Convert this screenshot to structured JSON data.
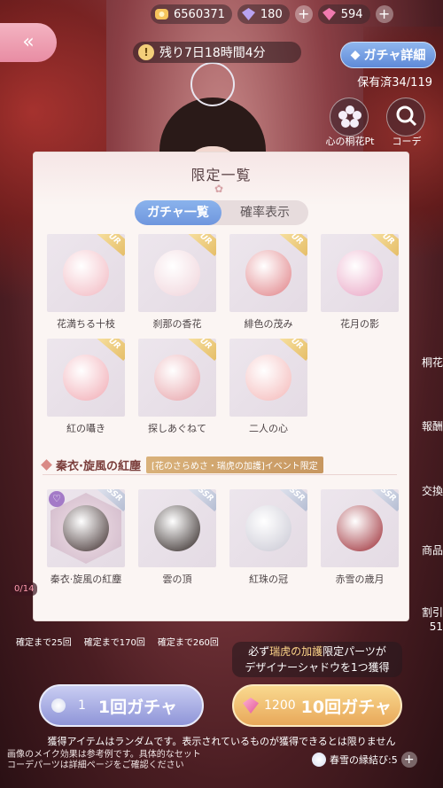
{
  "topbar": {
    "coins": "6560371",
    "diamonds": "180",
    "pink_gems": "594",
    "plus": "+"
  },
  "header": {
    "back_icon": "«",
    "timer": "残り7日18時間4分",
    "timer_icon": "!",
    "gacha_detail": "ガチャ詳細",
    "owned": "保有済34/119"
  },
  "side": {
    "flower_label": "心の桐花Pt",
    "coord_label": "コーデ"
  },
  "modal": {
    "title": "限定一覧",
    "title_deco": "✿",
    "tabs": [
      "ガチャ一覧",
      "確率表示"
    ],
    "items": [
      {
        "name": "花満ちる十枝",
        "rarity": "UR",
        "color": "#f2b7c0"
      },
      {
        "name": "刹那の香花",
        "rarity": "UR",
        "color": "#f0d3da"
      },
      {
        "name": "緋色の茂み",
        "rarity": "UR",
        "color": "#e07f84"
      },
      {
        "name": "花月の影",
        "rarity": "UR",
        "color": "#e9a3c3"
      },
      {
        "name": "紅の囁き",
        "rarity": "UR",
        "color": "#f1a9b2"
      },
      {
        "name": "探しあぐねて",
        "rarity": "UR",
        "color": "#e7a1a7"
      },
      {
        "name": "二人の心",
        "rarity": "UR",
        "color": "#f4b7b7"
      }
    ],
    "section": {
      "name": "秦衣·旋風の紅塵",
      "tag": "[花のさらめさ・瑞虎の加護]イベント限定"
    },
    "section_items": [
      {
        "name": "秦衣·旋風の紅塵",
        "rarity": "SSR",
        "color": "#3b2a2a"
      },
      {
        "name": "雲の頂",
        "rarity": "SSR",
        "color": "#2c2220"
      },
      {
        "name": "紅珠の冠",
        "rarity": "SSR",
        "color": "#c8c7d3"
      },
      {
        "name": "赤雪の歳月",
        "rarity": "SSR",
        "color": "#9a2730"
      }
    ]
  },
  "bottom": {
    "counts": [
      "確定まで25回",
      "確定まで170回",
      "確定まで260回"
    ],
    "promo_line1_pre": "必ず",
    "promo_line1_hl": "瑞虎の加護",
    "promo_line1_post": "限定パーツが",
    "promo_line2": "デザイナーシャドウを1つ獲得",
    "single_cost": "1",
    "single_label": "1回ガチャ",
    "ten_cost": "1200",
    "ten_label": "10回ガチャ",
    "notice": "獲得アイテムはランダムです。表示されているものが獲得できるとは限りません",
    "note2_line1": "画像のメイク効果は参考例です。具体的なセット",
    "note2_line2": "コーデパーツは詳細ページをご確認ください",
    "ticket": "春雪の縁結び:5",
    "left_counter": "0/14"
  },
  "right_edge": [
    "桐花",
    "報酬",
    "交換",
    "商品",
    "割引",
    "51"
  ]
}
